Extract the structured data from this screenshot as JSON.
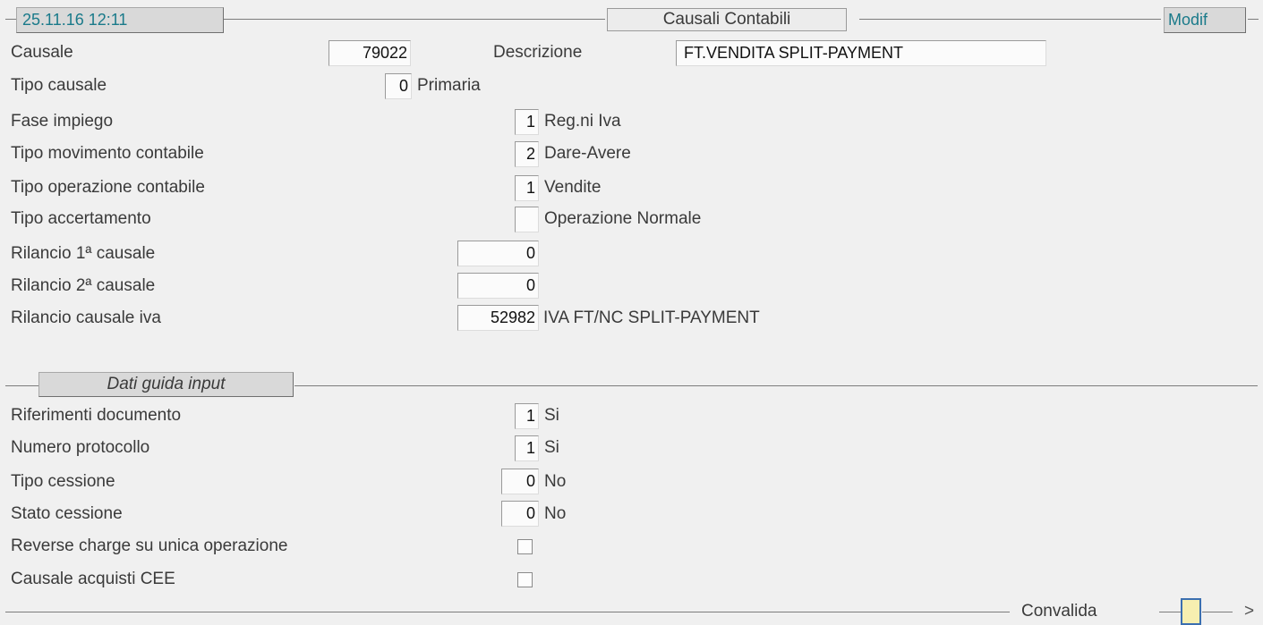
{
  "header": {
    "datetime": "25.11.16 12:11",
    "title": "Causali Contabili",
    "mode": "Modif"
  },
  "causale": {
    "label": "Causale",
    "value": "79022",
    "desc_label": "Descrizione",
    "desc_value": "FT.VENDITA SPLIT-PAYMENT"
  },
  "rows": {
    "tipo_causale": {
      "label": "Tipo causale",
      "value": "0",
      "desc": "Primaria"
    },
    "fase_impiego": {
      "label": "Fase impiego",
      "value": "1",
      "desc": "Reg.ni Iva"
    },
    "tipo_movimento": {
      "label": "Tipo movimento contabile",
      "value": "2",
      "desc": "Dare-Avere"
    },
    "tipo_operazione": {
      "label": "Tipo operazione contabile",
      "value": "1",
      "desc": "Vendite"
    },
    "tipo_accertamento": {
      "label": "Tipo accertamento",
      "value": "",
      "desc": "Operazione Normale"
    },
    "rilancio_1": {
      "label": "Rilancio 1ª causale",
      "value": "0"
    },
    "rilancio_2": {
      "label": "Rilancio 2ª causale",
      "value": "0"
    },
    "rilancio_iva": {
      "label": "Rilancio causale iva",
      "value": "52982",
      "desc": "IVA FT/NC SPLIT-PAYMENT"
    }
  },
  "guida": {
    "section_title": "Dati guida input",
    "riferimenti": {
      "label": "Riferimenti documento",
      "value": "1",
      "desc": "Si"
    },
    "protocollo": {
      "label": "Numero protocollo",
      "value": "1",
      "desc": "Si"
    },
    "tipo_cessione": {
      "label": "Tipo cessione",
      "value": "0",
      "desc": "No"
    },
    "stato_cessione": {
      "label": "Stato cessione",
      "value": "0",
      "desc": "No"
    },
    "reverse_charge": {
      "label": "Reverse charge su unica operazione",
      "checked": false
    },
    "acquisti_cee": {
      "label": "Causale acquisti CEE",
      "checked": false
    }
  },
  "footer": {
    "convalida": "Convalida",
    "next": ">"
  },
  "colors": {
    "header_text": "#1a7a8a",
    "background": "#f0f0f0",
    "confirm_fill": "#f6efb0",
    "confirm_border": "#3b6fb0"
  }
}
